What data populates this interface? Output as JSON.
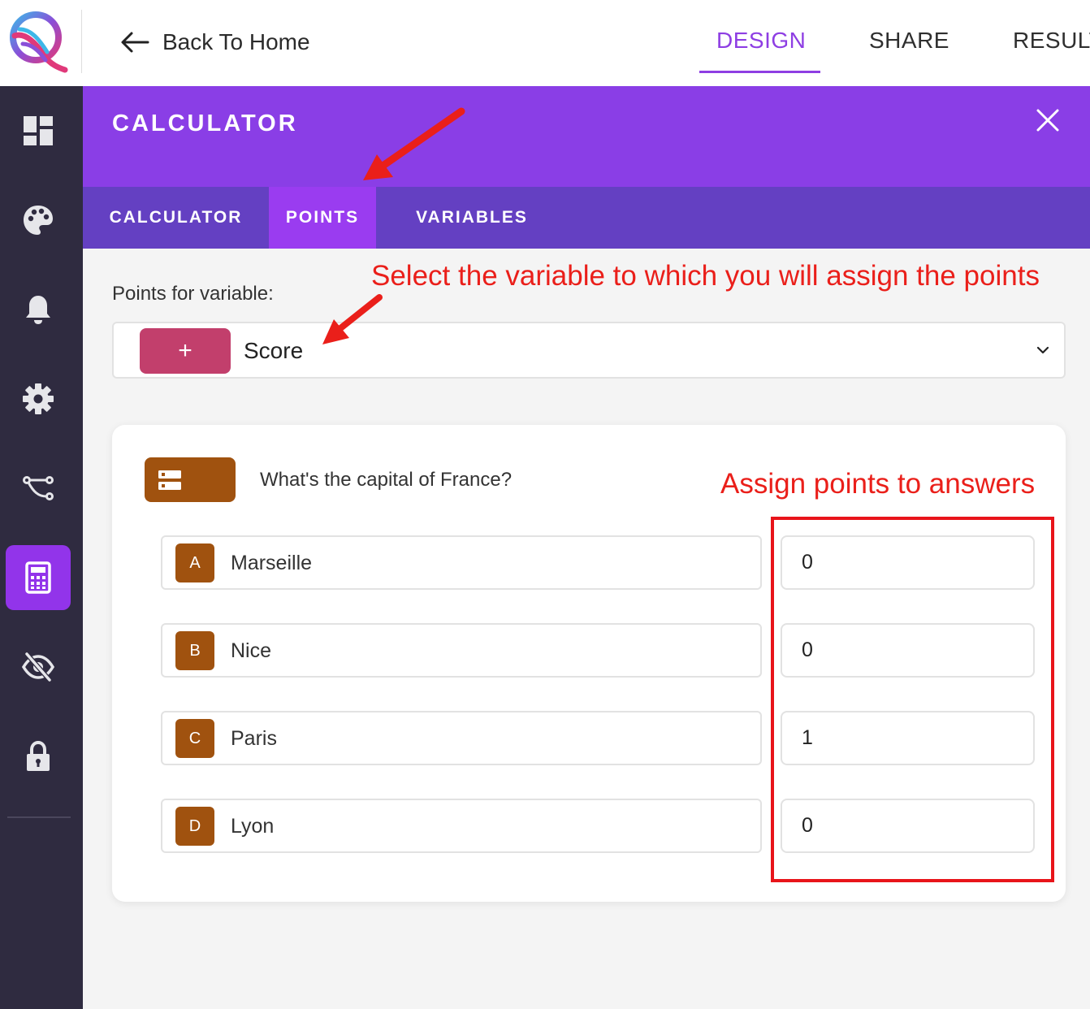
{
  "header": {
    "back_label": "Back To Home",
    "tabs": [
      {
        "label": "DESIGN",
        "active": true
      },
      {
        "label": "SHARE",
        "active": false
      },
      {
        "label": "RESULT",
        "active": false
      }
    ],
    "accent_color": "#8e3ee3"
  },
  "sidebar": {
    "items": [
      {
        "icon": "dashboard-icon",
        "active": false
      },
      {
        "icon": "palette-icon",
        "active": false
      },
      {
        "icon": "bell-icon",
        "active": false
      },
      {
        "icon": "gear-icon",
        "active": false
      },
      {
        "icon": "flow-icon",
        "active": false
      },
      {
        "icon": "calculator-icon",
        "active": true
      },
      {
        "icon": "eye-slash-icon",
        "active": false
      },
      {
        "icon": "lock-icon",
        "active": false
      }
    ]
  },
  "panel": {
    "title": "CALCULATOR",
    "subtabs": [
      {
        "label": "CALCULATOR",
        "active": false
      },
      {
        "label": "POINTS",
        "active": true
      },
      {
        "label": "VARIABLES",
        "active": false
      }
    ],
    "points_label": "Points for variable:",
    "variable": {
      "icon": "+",
      "name": "Score",
      "color": "#c23f6c"
    }
  },
  "question": {
    "text": "What's the capital of France?",
    "chip_color": "#a0520f",
    "answers": [
      {
        "letter": "A",
        "text": "Marseille",
        "points": "0"
      },
      {
        "letter": "B",
        "text": "Nice",
        "points": "0"
      },
      {
        "letter": "C",
        "text": "Paris",
        "points": "1"
      },
      {
        "letter": "D",
        "text": "Lyon",
        "points": "0"
      }
    ]
  },
  "annotations": {
    "select_variable": "Select the variable to which you will assign the points",
    "assign_points": "Assign points to answers",
    "color": "#ea1f1a"
  }
}
